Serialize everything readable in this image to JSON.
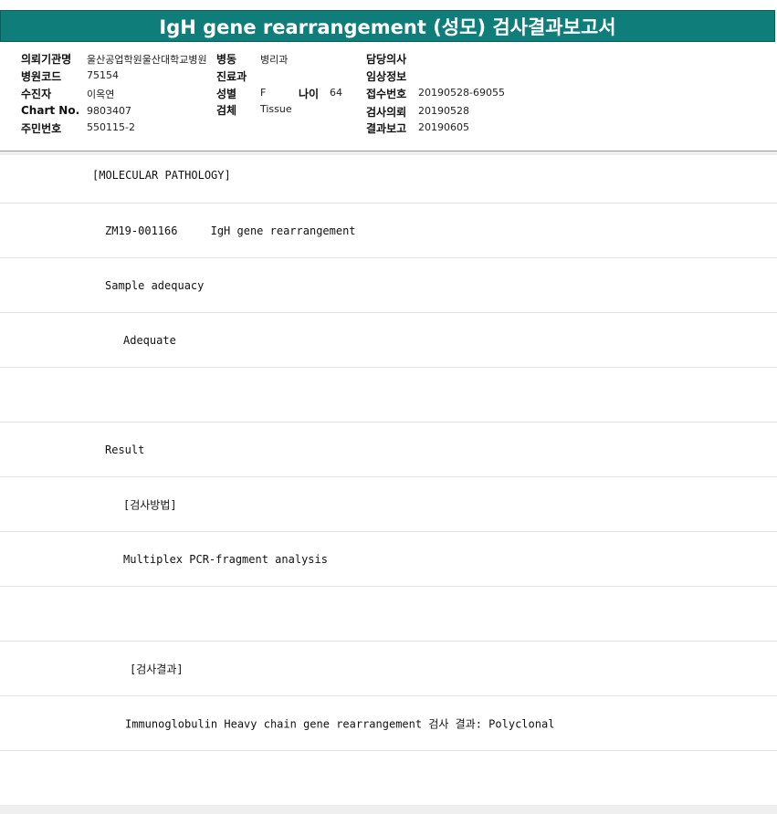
{
  "title": "IgH gene rearrangement (성모) 검사결과보고서",
  "header": {
    "institution_label": "의뢰기관명",
    "institution_value": "울산공업학원울산대학교병원",
    "ward_label": "병동",
    "ward_value": "병리과",
    "doctor_label": "담당의사",
    "doctor_value": "",
    "hospital_code_label": "병원코드",
    "hospital_code_value": "75154",
    "department_label": "진료과",
    "department_value": "",
    "clinical_info_label": "임상정보",
    "clinical_info_value": "",
    "patient_label": "수진자",
    "patient_value": "이옥연",
    "sex_label": "성별",
    "sex_value": "F",
    "age_label": "나이",
    "age_value": "64",
    "accession_label": "접수번호",
    "accession_value": "20190528-69055",
    "chart_label": "Chart No.",
    "chart_value": "9803407",
    "specimen_label": "검체",
    "specimen_value": "Tissue",
    "request_label": "검사의뢰",
    "request_value": "20190528",
    "id_label": "주민번호",
    "id_value": "550115-2",
    "report_date_label": "결과보고",
    "report_date_value": "20190605"
  },
  "report_lines": [
    "[MOLECULAR PATHOLOGY]",
    "ZM19-001166     IgH gene rearrangement",
    "Sample adequacy",
    "Adequate",
    "",
    "Result",
    "[검사방법]",
    "Multiplex PCR-fragment analysis",
    "",
    "[검사결과]",
    "Immunoglobulin Heavy chain gene rearrangement 검사 결과: Polyclonal",
    ""
  ]
}
